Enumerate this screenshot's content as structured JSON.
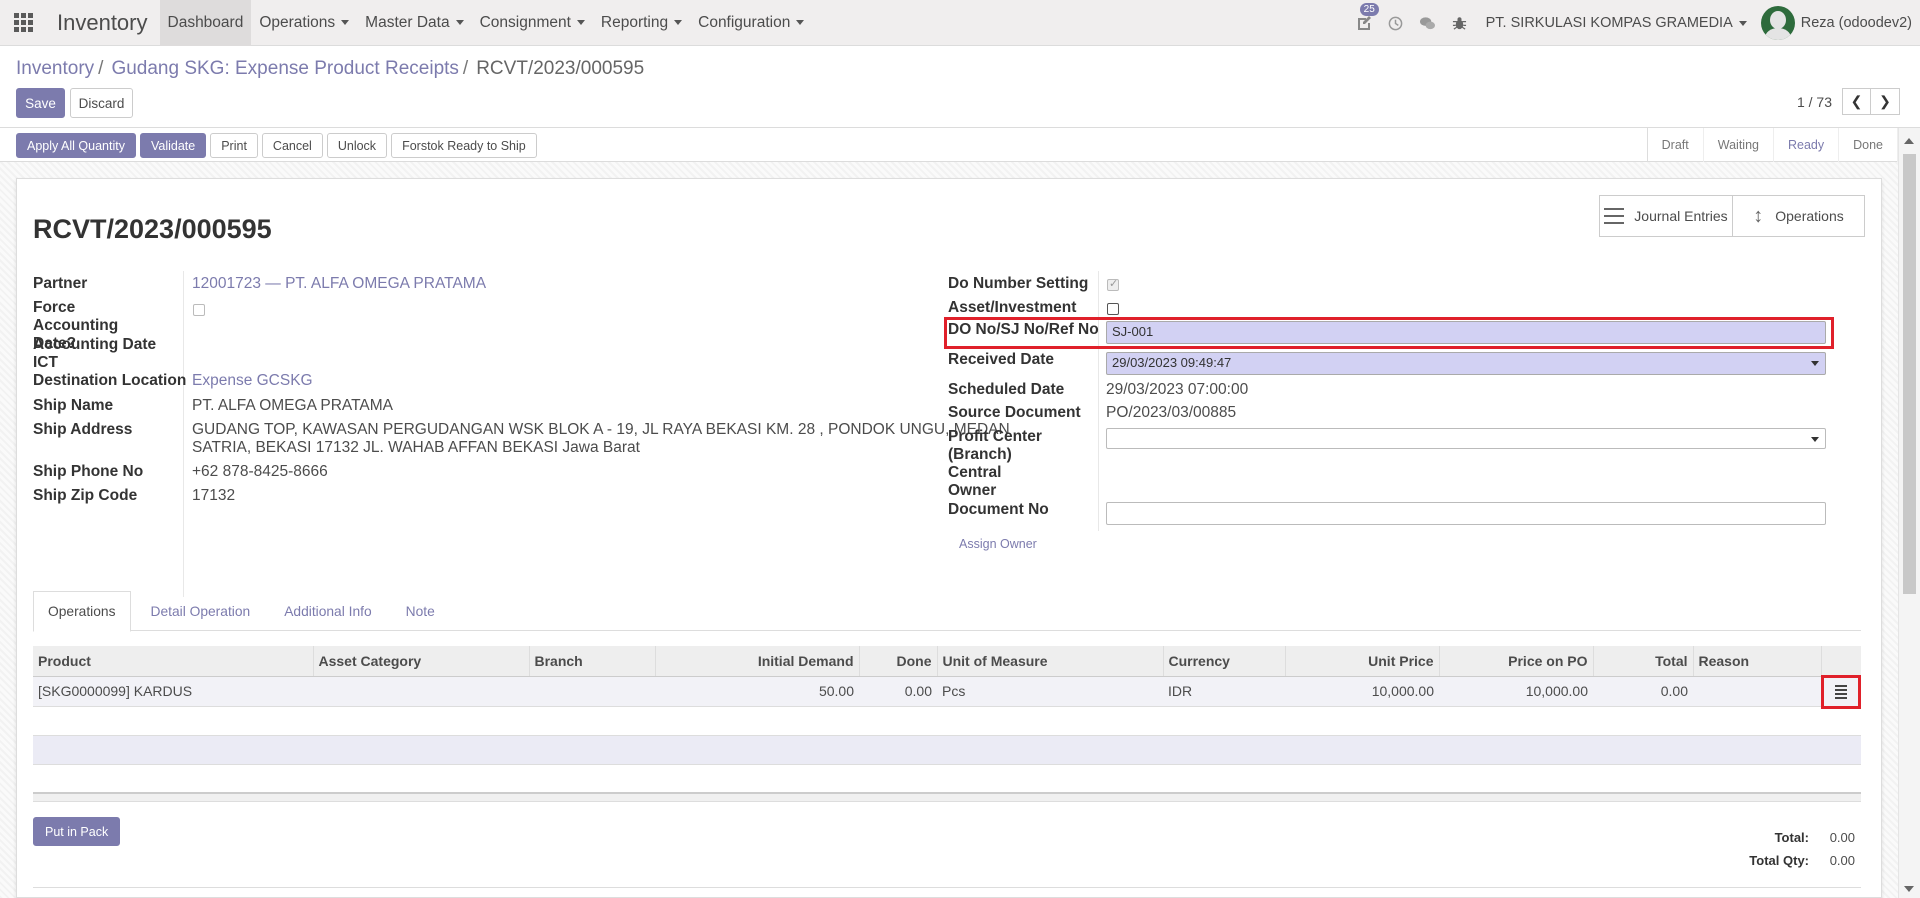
{
  "app": {
    "brand": "Inventory",
    "menu": [
      "Dashboard",
      "Operations",
      "Master Data",
      "Consignment",
      "Reporting",
      "Configuration"
    ],
    "activity_count": "25",
    "company": "PT. SIRKULASI KOMPAS GRAMEDIA",
    "user": "Reza (odoodev2)"
  },
  "breadcrumb": {
    "items": [
      "Inventory",
      "Gudang SKG: Expense Product Receipts"
    ],
    "current": "RCVT/2023/000595"
  },
  "controls": {
    "save": "Save",
    "discard": "Discard",
    "pager": "1 / 73"
  },
  "actions": [
    "Apply All Quantity",
    "Validate",
    "Print",
    "Cancel",
    "Unlock",
    "Forstok Ready to Ship"
  ],
  "stages": [
    "Draft",
    "Waiting",
    "Ready",
    "Done"
  ],
  "smart_buttons": [
    "Journal Entries",
    "Operations"
  ],
  "record": {
    "title": "RCVT/2023/000595",
    "left_fields": {
      "partner_label": "Partner",
      "partner_value": "12001723 — PT. ALFA OMEGA PRATAMA",
      "force_label": "Force Accounting Date?",
      "accounting_date_label": "Accounting Date",
      "ict_label": "ICT",
      "dest_label": "Destination Location",
      "dest_value": "Expense GCSKG",
      "ship_name_label": "Ship Name",
      "ship_name_value": "PT. ALFA OMEGA PRATAMA",
      "ship_address_label": "Ship Address",
      "ship_address_line1": "GUDANG TOP, KAWASAN PERGUDANGAN WSK BLOK A - 19, JL RAYA BEKASI KM. 28 , PONDOK UNGU, MEDAN",
      "ship_address_line2": "SATRIA, BEKASI 17132 JL. WAHAB AFFAN BEKASI Jawa Barat",
      "ship_phone_label": "Ship Phone No",
      "ship_phone_value": "+62 878-8425-8666",
      "ship_zip_label": "Ship Zip Code",
      "ship_zip_value": "17132"
    },
    "right_fields": {
      "do_setting_label": "Do Number Setting",
      "asset_label": "Asset/Investment",
      "do_ref_label": "DO No/SJ No/Ref No",
      "do_ref_value": "SJ-001",
      "received_label": "Received Date",
      "received_value": "29/03/2023 09:49:47",
      "scheduled_label": "Scheduled Date",
      "scheduled_value": "29/03/2023 07:00:00",
      "source_label": "Source Document",
      "source_value": "PO/2023/03/00885",
      "profit_label_1": "Profit Center",
      "profit_label_2": "(Branch)",
      "central_label": "Central",
      "owner_label": "Owner",
      "docno_label": "Document No",
      "docno_value": "",
      "assign_owner": "Assign Owner"
    }
  },
  "tabs": [
    "Operations",
    "Detail Operation",
    "Additional Info",
    "Note"
  ],
  "table": {
    "columns": [
      "Product",
      "Asset Category",
      "Branch",
      "Initial Demand",
      "Done",
      "Unit of Measure",
      "Currency",
      "Unit Price",
      "Price on PO",
      "Total",
      "Reason",
      ""
    ],
    "rows": [
      [
        "[SKG0000099] KARDUS",
        "",
        "",
        "50.00",
        "0.00",
        "Pcs",
        "IDR",
        "10,000.00",
        "10,000.00",
        "0.00",
        ""
      ]
    ]
  },
  "footer": {
    "put_in_pack": "Put in Pack",
    "total_label": "Total:",
    "total_value": "0.00",
    "total_qty_label": "Total Qty:",
    "total_qty_value": "0.00"
  }
}
